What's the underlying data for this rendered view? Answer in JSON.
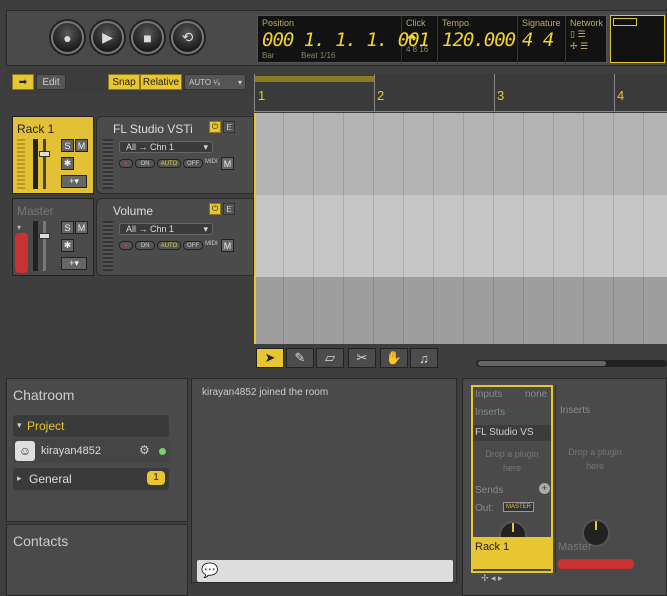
{
  "transport": {
    "record_icon": "record-icon",
    "play_icon": "play-icon",
    "stop_icon": "stop-icon",
    "loop_icon": "loop-icon"
  },
  "display": {
    "position_label": "Position",
    "position_value": "000 1. 1. 1. 001",
    "bar_label": "Bar",
    "beat_label": "Beat",
    "beat_sub": "1/16",
    "click_label": "Click",
    "click_sub": "4  8  16",
    "tempo_label": "Tempo",
    "tempo_value": "120.000",
    "signature_label": "Signature",
    "signature_value": "4 4",
    "network_label": "Network"
  },
  "toolbar": {
    "edit_label": "Edit",
    "snap_label": "Snap",
    "relative_label": "Relative",
    "auto_label": "AUTO ¹⁄₈"
  },
  "tracks": [
    {
      "name": "Rack 1",
      "plugin": "FL Studio VSTi",
      "routing": "All → Chn 1",
      "s": "S",
      "m": "M",
      "on": "ON",
      "auto": "AUTO",
      "off": "OFF",
      "midi": "MIDI",
      "mbtn": "M"
    },
    {
      "name": "Master",
      "plugin": "Volume",
      "routing": "All → Chn 1",
      "s": "S",
      "m": "M",
      "on": "ON",
      "auto": "AUTO",
      "off": "OFF",
      "midi": "MIDI",
      "mbtn": "M"
    }
  ],
  "ruler": {
    "bars": [
      "1",
      "2",
      "3",
      "4"
    ]
  },
  "chat": {
    "title": "Chatroom",
    "project_label": "Project",
    "user": "kirayan4852",
    "general_label": "General",
    "general_count": "1",
    "contacts_label": "Contacts",
    "message": "kirayan4852 joined the room"
  },
  "mixer": {
    "inputs_label": "Inputs",
    "inputs_value": "none",
    "inserts_label": "Inserts",
    "insert_plugin": "FL Studio VS",
    "drop_plugin": "Drop a plugin here",
    "sends_label": "Sends",
    "out_label": "Out:",
    "out_value": "MASTER",
    "rack_name": "Rack 1",
    "master_name": "Master"
  },
  "colors": {
    "accent": "#e8c632",
    "record_red": "#c83232"
  }
}
